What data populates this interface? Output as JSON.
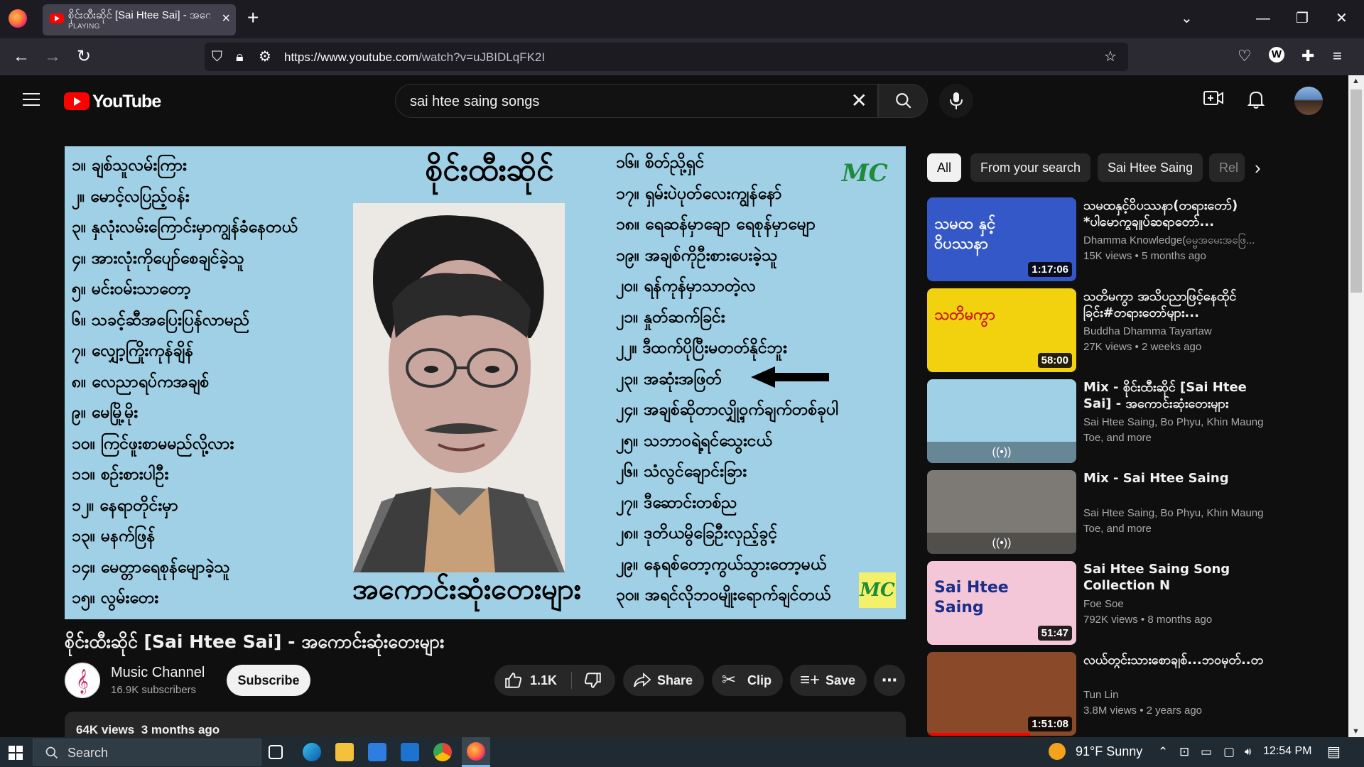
{
  "browser": {
    "tab_title": "စိုင်းထီးဆိုင် [Sai Htee Sai] - အကေ",
    "tab_status": "PLAYING",
    "url_host": "https://www.youtube.com",
    "url_path": "/watch?v=uJBIDLqFK2I",
    "colors": {
      "tabbar": "#1c1b22",
      "toolbar": "#2b2a33"
    }
  },
  "youtube": {
    "logo_text": "YouTube",
    "search_query": "sai htee saing songs"
  },
  "video": {
    "title": "စိုင်းထီးဆိုင် [Sai Htee Sai] - အကောင်းဆုံးတေးများ",
    "thumb_title": "စိုင်းထီးဆိုင်",
    "thumb_subtitle": "အကောင်းဆုံးတေးများ",
    "watermark": "MC",
    "songs_left": [
      "၁။ ချစ်သူလမ်းကြား",
      "၂။ မောင့်လပြည့်ဝန်း",
      "၃။ နှလုံးလမ်းကြောင်းမှာကျွန်ခံနေတယ်",
      "၄။ အားလုံးကိုပျော်စေချင်ခဲ့သူ",
      "၅။ မင်းဝမ်းသာတော့",
      "၆။ သခင့်ဆီအပြေးပြန်လာမည်",
      "၇။ လျှော့ကြိုးကုန်ချိန်",
      "၈။ လေညာရပ်ကအချစ်",
      "၉။ မေမြို့မိုး",
      "၁၀။ ကြင်ဖူးစာမမည်လို့လား",
      "၁၁။ စဉ်းစားပါဦး",
      "၁၂။ နေရာတိုင်းမှာ",
      "၁၃။ မနက်ဖြန်",
      "၁၄။ မေတ္တာရေစုန်မျောခဲ့သူ",
      "၁၅။ လွမ်းတေး"
    ],
    "songs_right": [
      "၁၆။ စိတ်ညို့ရှင်",
      "၁၇။ ရှမ်းပဲပုတ်လေးကျွန်နော်",
      "၁၈။ ရေဆန်မှာချော ရေစုန်မှာမျော",
      "၁၉။ အချစ်ကိုဦးစားပေးခဲ့သူ",
      "၂၀။ ရန်ကုန်မှာသာတဲ့လ",
      "၂၁။ နှုတ်ဆက်ခြင်း",
      "၂၂။ ဒီထက်ပိုပြီးမတတ်နိုင်ဘူး",
      "၂၃။ အဆုံးအဖြတ်",
      "၂၄။ အချစ်ဆိုတာလျှို့ဝှက်ချက်တစ်ခုပါ",
      "၂၅။ သဘာဝရဲ့ရင်သွေးငယ်",
      "၂၆။ သံလွင်ချောင်းခြား",
      "၂၇။ ဒီဆောင်းတစ်ည",
      "၂၈။ ဒုတိယမွိခြေဦးလှည့်ခွင့်",
      "၂၉။ နေရစ်တော့ကွယ်သွားတော့မယ်",
      "၃၀။ အရင်လိုဘဝမျိုးရောက်ချင်တယ်"
    ],
    "channel": {
      "name": "Music Channel",
      "subscribers": "16.9K subscribers"
    },
    "subscribe_label": "Subscribe",
    "likes": "1.1K",
    "share_label": "Share",
    "clip_label": "Clip",
    "save_label": "Save",
    "views": "64K views",
    "age": "3 months ago"
  },
  "chips": [
    "All",
    "From your search",
    "Sai Htee Saing",
    "Rel"
  ],
  "recommendations": [
    {
      "title": "သမထနှင့်ဝိပဿနာ(တရားတော်) *ပါမောက္ခချုပ်ဆရာတော်...",
      "channel": "Dhamma Knowledge(ဓမ္မအမေးအဖြေ...",
      "views": "15K views",
      "age": "5 months ago",
      "duration": "1:17:06",
      "thumb_text": "သမထ နှင့် ဝိပဿနာ",
      "thumb_bg": "#3558c9"
    },
    {
      "title": "သတိမကွာ အသိပညာဖြင့်နေထိုင်ခြင်း#တရားတော်များ...",
      "channel": "Buddha Dhamma Tayartaw",
      "views": "27K views",
      "age": "2 weeks ago",
      "duration": "58:00",
      "thumb_text": "သတိမကွာ",
      "thumb_bg": "#f2d20f"
    },
    {
      "title": "Mix - စိုင်းထီးဆိုင် [Sai Htee Sai] - အကောင်းဆုံးတေးများ",
      "channel": "Sai Htee Saing, Bo Phyu, Khin Maung Toe, and more",
      "views": "",
      "age": "",
      "duration": "",
      "thumb_text": "",
      "thumb_bg": "#9fd0e6"
    },
    {
      "title": "Mix - Sai Htee Saing",
      "channel": "Sai Htee Saing, Bo Phyu, Khin Maung Toe, and more",
      "views": "",
      "age": "",
      "duration": "",
      "thumb_text": "",
      "thumb_bg": "#7d7a75"
    },
    {
      "title": "Sai Htee Saing Song Collection N",
      "channel": "Foe Soe",
      "views": "792K views",
      "age": "8 months ago",
      "duration": "51:47",
      "thumb_text": "Sai Htee Saing",
      "thumb_bg": "#f4c7d8"
    },
    {
      "title": "လယ်တွင်းသားစောချစ်...ဘဝမှတ်..တ",
      "channel": "Tun Lin",
      "views": "3.8M views",
      "age": "2 years ago",
      "duration": "1:51:08",
      "thumb_text": "",
      "thumb_bg": "#8a4a2a"
    }
  ],
  "taskbar": {
    "search_placeholder": "Search",
    "temperature": "91°F",
    "weather": "Sunny",
    "time": "12:54 PM"
  }
}
